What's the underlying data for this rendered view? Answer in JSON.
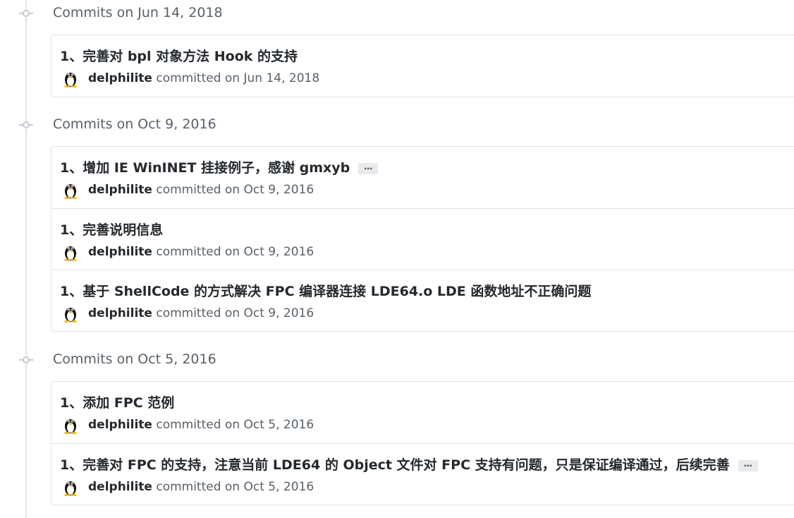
{
  "groups": [
    {
      "title": "Commits on Jun 14, 2018",
      "commits": [
        {
          "title": "1、完善对 bpl 对象方法 Hook 的支持",
          "has_more": false,
          "author": "delphilite",
          "info": "committed on Jun 14, 2018"
        }
      ]
    },
    {
      "title": "Commits on Oct 9, 2016",
      "commits": [
        {
          "title": "1、增加 IE WinINET 挂接例子，感谢 gmxyb",
          "has_more": true,
          "more_label": "…",
          "author": "delphilite",
          "info": "committed on Oct 9, 2016"
        },
        {
          "title": "1、完善说明信息",
          "has_more": false,
          "author": "delphilite",
          "info": "committed on Oct 9, 2016"
        },
        {
          "title": "1、基于 ShellCode 的方式解决 FPC 编译器连接 LDE64.o LDE 函数地址不正确问题",
          "has_more": false,
          "author": "delphilite",
          "info": "committed on Oct 9, 2016"
        }
      ]
    },
    {
      "title": "Commits on Oct 5, 2016",
      "commits": [
        {
          "title": "1、添加 FPC 范例",
          "has_more": false,
          "author": "delphilite",
          "info": "committed on Oct 5, 2016"
        },
        {
          "title": "1、完善对 FPC 的支持，注意当前 LDE64 的 Object 文件对 FPC 支持有问题，只是保证编译通过，后续完善",
          "has_more": true,
          "more_label": "…",
          "author": "delphilite",
          "info": "committed on Oct 5, 2016"
        }
      ]
    }
  ],
  "icons": {
    "timeline_node": "git-commit-icon",
    "avatar": "penguin-avatar"
  },
  "colors": {
    "timeline": "#e1e4e8",
    "title_text": "#24292e",
    "muted_text": "#586069",
    "ellipsis_bg": "#e8eaed"
  }
}
